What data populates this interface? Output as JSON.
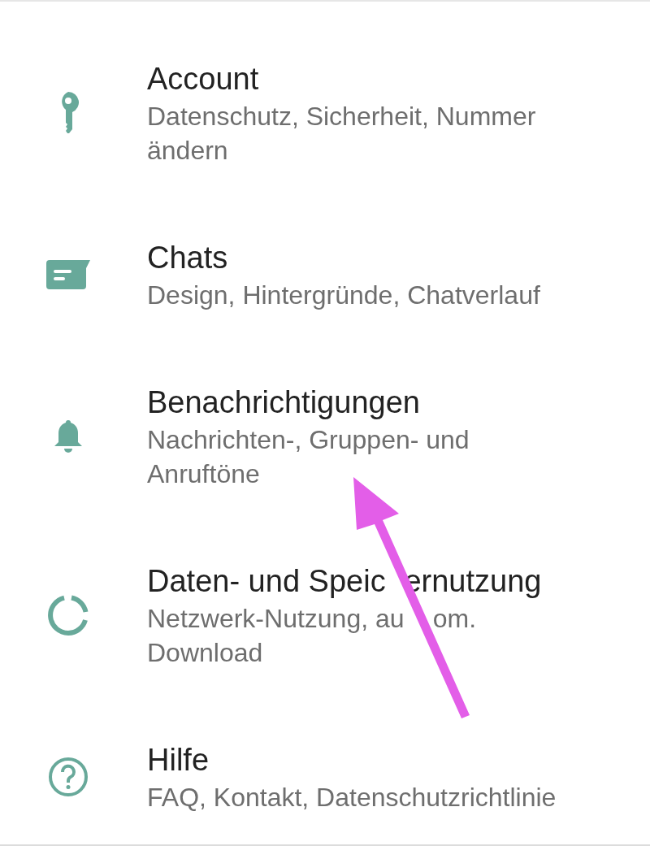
{
  "settings": [
    {
      "title": [
        "Account"
      ],
      "subtitle": [
        [
          "Datenschutz, Sicherheit, Nummer"
        ],
        [
          "ändern"
        ]
      ]
    },
    {
      "title": [
        "Chats"
      ],
      "subtitle": [
        [
          "Design, Hintergründe, Chatverlauf"
        ]
      ]
    },
    {
      "title": [
        "Benachrichtigungen"
      ],
      "subtitle": [
        [
          "Nachrichten-, Gruppen- und"
        ],
        [
          "Anruftöne"
        ]
      ]
    },
    {
      "title": [
        "Daten- und Speic",
        "ernutzung"
      ],
      "subtitle": [
        [
          "Netzwerk-Nutzung, au",
          "om."
        ],
        [
          "Download"
        ]
      ]
    },
    {
      "title": [
        "Hilfe"
      ],
      "subtitle": [
        [
          "FAQ, Kontakt, Datenschutzrichtlinie"
        ]
      ]
    }
  ]
}
